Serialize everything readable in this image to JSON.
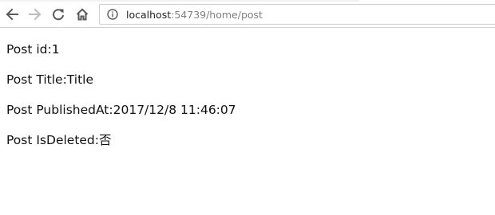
{
  "browser": {
    "url_host": "localhost",
    "url_rest": ":54739/home/post",
    "icons": {
      "back": "back-arrow-icon",
      "forward": "forward-arrow-icon",
      "reload": "reload-icon",
      "home": "home-icon",
      "site_info": "info-icon"
    }
  },
  "page": {
    "lines": [
      "Post id:1",
      "Post Title:Title",
      "Post PublishedAt:2017/12/8 11:46:07",
      "Post IsDeleted:否"
    ]
  }
}
